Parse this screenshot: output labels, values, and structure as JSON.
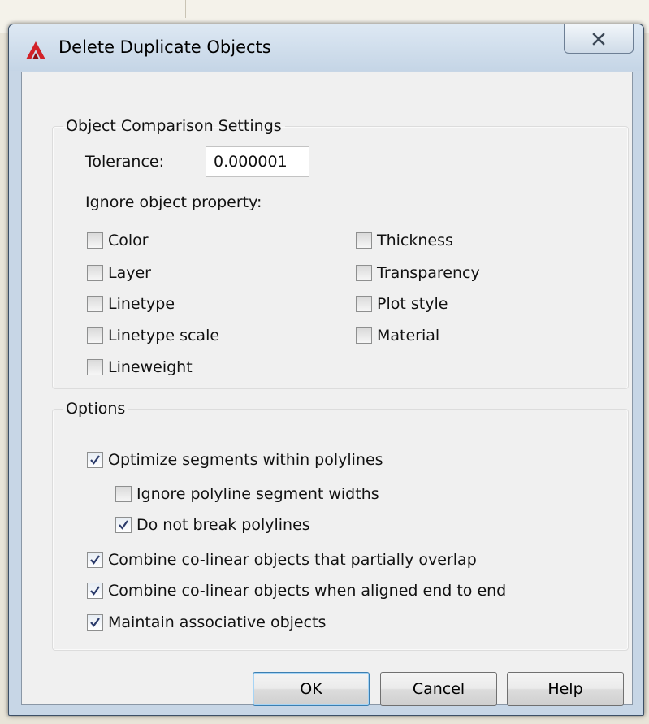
{
  "window": {
    "title": "Delete Duplicate Objects",
    "app_icon": "autocad-a-icon",
    "close_icon": "close-x-icon"
  },
  "comparison": {
    "legend": "Object Comparison Settings",
    "tolerance_label": "Tolerance:",
    "tolerance_value": "0.000001",
    "ignore_label": "Ignore object property:",
    "properties": [
      {
        "label": "Color",
        "checked": false
      },
      {
        "label": "Layer",
        "checked": false
      },
      {
        "label": "Linetype",
        "checked": false
      },
      {
        "label": "Linetype scale",
        "checked": false
      },
      {
        "label": "Lineweight",
        "checked": false
      },
      {
        "label": "Thickness",
        "checked": false
      },
      {
        "label": "Transparency",
        "checked": false
      },
      {
        "label": "Plot style",
        "checked": false
      },
      {
        "label": "Material",
        "checked": false
      }
    ]
  },
  "options": {
    "legend": "Options",
    "items": [
      {
        "label": "Optimize segments within polylines",
        "checked": true
      },
      {
        "label": "Ignore polyline segment widths",
        "checked": false
      },
      {
        "label": "Do not break polylines",
        "checked": true
      },
      {
        "label": "Combine co-linear objects that partially overlap",
        "checked": true
      },
      {
        "label": "Combine co-linear objects when aligned end to end",
        "checked": true
      },
      {
        "label": "Maintain associative objects",
        "checked": true
      }
    ]
  },
  "buttons": {
    "ok": "OK",
    "cancel": "Cancel",
    "help": "Help"
  },
  "colors": {
    "window_frame": "#c7d6e6",
    "client_bg": "#f0f0f0",
    "check_mark": "#2a3a6a",
    "autocad_red": "#d22229"
  }
}
